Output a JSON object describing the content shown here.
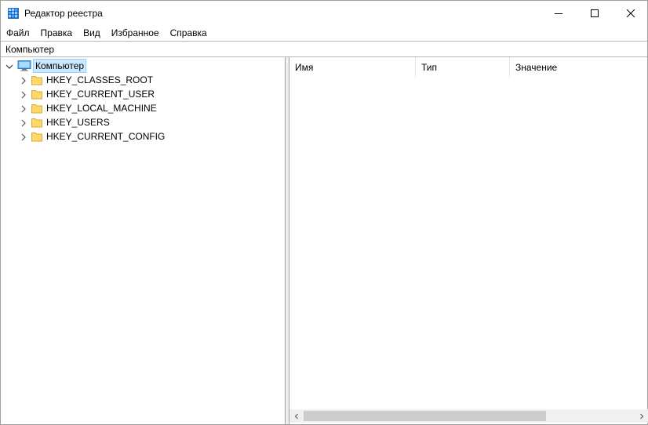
{
  "window": {
    "title": "Редактор реестра"
  },
  "menu": {
    "items": [
      "Файл",
      "Правка",
      "Вид",
      "Избранное",
      "Справка"
    ]
  },
  "address": {
    "value": "Компьютер"
  },
  "tree": {
    "root_label": "Компьютер",
    "items": [
      {
        "label": "HKEY_CLASSES_ROOT"
      },
      {
        "label": "HKEY_CURRENT_USER"
      },
      {
        "label": "HKEY_LOCAL_MACHINE"
      },
      {
        "label": "HKEY_USERS"
      },
      {
        "label": "HKEY_CURRENT_CONFIG"
      }
    ]
  },
  "list": {
    "columns": {
      "name": "Имя",
      "type": "Тип",
      "value": "Значение"
    }
  },
  "colors": {
    "selection_bg": "#cce8ff",
    "folder": "#ffd86b",
    "window_border": "#a0a0a0"
  }
}
